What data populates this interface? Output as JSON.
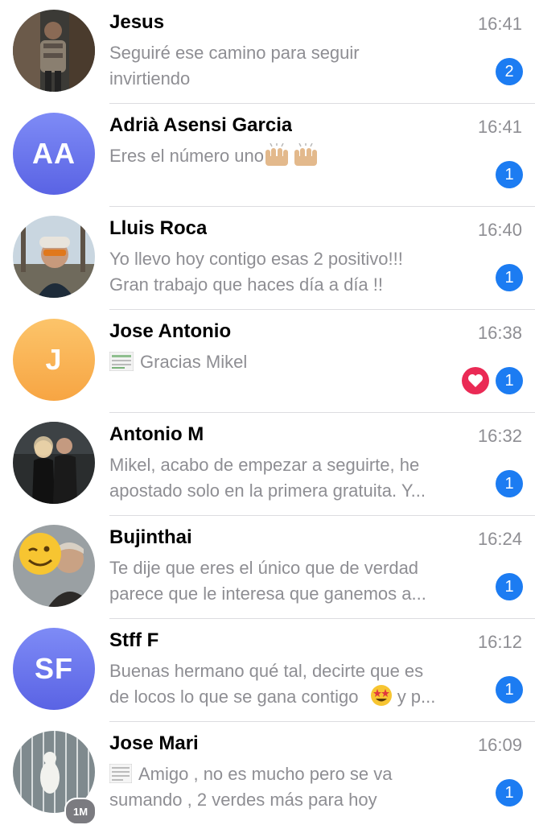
{
  "chats": [
    {
      "name": "Jesus",
      "time": "16:41",
      "message_lines": [
        "Seguiré ese camino para seguir",
        "invirtiendo"
      ],
      "unread": "2",
      "avatar": "photo-man-mirror-selfie"
    },
    {
      "name": "Adrià Asensi Garcia",
      "time": "16:41",
      "message_lines": [
        "Eres el número uno"
      ],
      "message_emoji": "raising-hands-emoji x2",
      "unread": "1",
      "avatar_initials": "AA"
    },
    {
      "name": "Lluis Roca",
      "time": "16:40",
      "message_lines": [
        "Yo llevo hoy contigo esas 2 positivo!!!",
        "Gran trabajo que haces día a día !!"
      ],
      "unread": "1",
      "avatar": "photo-man-cap-sunglasses"
    },
    {
      "name": "Jose Antonio",
      "time": "16:38",
      "message_lines": [
        "Gracias Mikel"
      ],
      "message_thumbnail": "image-thumbnail",
      "reaction": "heart-icon",
      "unread": "1",
      "avatar_initials": "J"
    },
    {
      "name": "Antonio M",
      "time": "16:32",
      "message_lines": [
        "Mikel, acabo de empezar a seguirte, he",
        "apostado solo en la primera gratuita. Y..."
      ],
      "unread": "1",
      "avatar": "photo-couple"
    },
    {
      "name": "Bujinthai",
      "time": "16:24",
      "message_lines": [
        "Te dije que eres el único que de verdad",
        "parece que le interesa que ganemos a..."
      ],
      "unread": "1",
      "avatar": "photo-winking-emoji-man"
    },
    {
      "name": "Stff F",
      "time": "16:12",
      "message_lines": [
        "Buenas hermano qué tal, decirte que es",
        "de locos lo que se gana contigo",
        " y p..."
      ],
      "message_emoji": "star-struck-emoji",
      "unread": "1",
      "avatar_initials": "SF"
    },
    {
      "name": "Jose Mari",
      "time": "16:09",
      "message_lines": [
        "Amigo , no es mucho pero se va",
        "sumando , 2 verdes más para hoy"
      ],
      "message_thumbnail": "image-thumbnail",
      "unread": "1",
      "avatar": "photo-bird-cage",
      "avatar_badge": "1M"
    }
  ],
  "colors": {
    "badge": "#1c7cf2",
    "heart": "#ea2a55",
    "secondary_text": "#8e8e93",
    "separator": "#dcdce0"
  }
}
